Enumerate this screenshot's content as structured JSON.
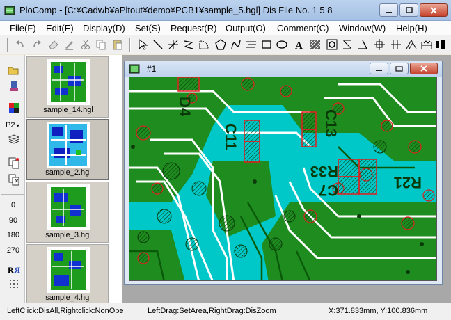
{
  "window": {
    "title": "PloComp - [C:¥Cadwb¥aPltout¥demo¥PCB1¥sample_5.hgl] Dis File No. 1 5 8"
  },
  "menu": [
    {
      "label": "File(F)"
    },
    {
      "label": "Edit(E)"
    },
    {
      "label": "Display(D)"
    },
    {
      "label": "Set(S)"
    },
    {
      "label": "Request(R)"
    },
    {
      "label": "Output(O)"
    },
    {
      "label": "Comment(C)"
    },
    {
      "label": "Window(W)"
    },
    {
      "label": "Help(H)"
    }
  ],
  "left_tools": {
    "layer_label": "P2",
    "angles": [
      "0",
      "90",
      "180",
      "270"
    ]
  },
  "thumbnails": [
    {
      "label": "sample_14.hgl"
    },
    {
      "label": "sample_2.hgl"
    },
    {
      "label": "sample_3.hgl"
    },
    {
      "label": "sample_4.hgl"
    }
  ],
  "document": {
    "title": "#1",
    "board_labels": [
      "D4",
      "C11",
      "C13",
      "R33",
      "C7",
      "R21"
    ]
  },
  "status": {
    "hint": "LeftClick:DisAll,Rightclick:NonOpe",
    "drag_hint": "LeftDrag:SetArea,RightDrag:DisZoom",
    "coords": "X:371.833mm, Y:100.836mm"
  },
  "colors": {
    "board_green": "#1e8c1e",
    "board_cyan": "#00c8c8",
    "trace_white": "#ffffff",
    "pad_red": "#e02020",
    "silkscreen": "#0a3a0a"
  }
}
